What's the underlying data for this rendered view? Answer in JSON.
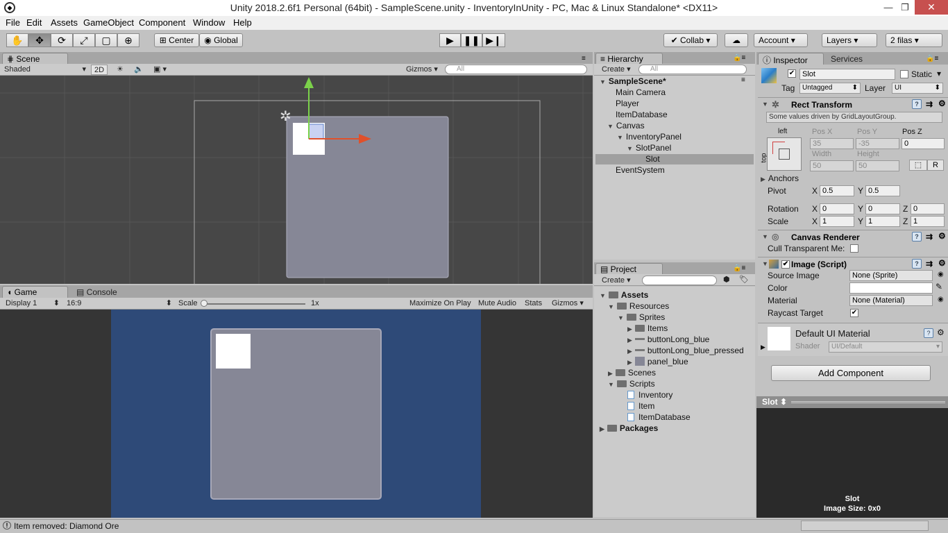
{
  "window": {
    "title": "Unity 2018.2.6f1 Personal (64bit) - SampleScene.unity - InventoryInUnity - PC, Mac & Linux Standalone* <DX11>"
  },
  "menu": [
    "File",
    "Edit",
    "Assets",
    "GameObject",
    "Component",
    "Window",
    "Help"
  ],
  "toolbar": {
    "center": "Center",
    "global": "Global",
    "collab": "Collab",
    "account": "Account",
    "layers": "Layers",
    "layout": "2 filas"
  },
  "scene": {
    "tab": "Scene",
    "shading": "Shaded",
    "mode_2d": "2D",
    "gizmos": "Gizmos",
    "search_placeholder": "All"
  },
  "game": {
    "tab": "Game",
    "console_tab": "Console",
    "display": "Display 1",
    "aspect": "16:9",
    "scale_label": "Scale",
    "scale_value": "1x",
    "maximize": "Maximize On Play",
    "mute": "Mute Audio",
    "stats": "Stats",
    "gizmos": "Gizmos"
  },
  "hierarchy": {
    "tab": "Hierarchy",
    "create": "Create",
    "search_placeholder": "All",
    "scene": "SampleScene*",
    "items": [
      "Main Camera",
      "Player",
      "ItemDatabase",
      "Canvas",
      "InventoryPanel",
      "SlotPanel",
      "Slot",
      "EventSystem"
    ]
  },
  "project": {
    "tab": "Project",
    "create": "Create",
    "items": [
      "Assets",
      "Resources",
      "Sprites",
      "Items",
      "buttonLong_blue",
      "buttonLong_blue_pressed",
      "panel_blue",
      "Scenes",
      "Scripts",
      "Inventory",
      "Item",
      "ItemDatabase",
      "Packages"
    ]
  },
  "inspector": {
    "tab": "Inspector",
    "services_tab": "Services",
    "object_name": "Slot",
    "static": "Static",
    "tag_label": "Tag",
    "tag_value": "Untagged",
    "layer_label": "Layer",
    "layer_value": "UI",
    "rect_transform": "Rect Transform",
    "driven_note": "Some values driven by GridLayoutGroup.",
    "anchor_h": "left",
    "anchor_v": "top",
    "posx_label": "Pos X",
    "posy_label": "Pos Y",
    "posz_label": "Pos Z",
    "posx": "35",
    "posy": "-35",
    "posz": "0",
    "width_label": "Width",
    "height_label": "Height",
    "width": "50",
    "height": "50",
    "r_button": "R",
    "anchors": "Anchors",
    "pivot_label": "Pivot",
    "pivot_x": "0.5",
    "pivot_y": "0.5",
    "rotation_label": "Rotation",
    "rot_x": "0",
    "rot_y": "0",
    "rot_z": "0",
    "scale_label": "Scale",
    "scale_x": "1",
    "scale_y": "1",
    "scale_z": "1",
    "x": "X",
    "y": "Y",
    "z": "Z",
    "canvas_renderer": "Canvas Renderer",
    "cull": "Cull Transparent Me:",
    "image_script": "Image (Script)",
    "source_image_label": "Source Image",
    "source_image": "None (Sprite)",
    "color_label": "Color",
    "material_label": "Material",
    "material": "None (Material)",
    "raycast_label": "Raycast Target",
    "default_material": "Default UI Material",
    "shader_label": "Shader",
    "shader_value": "UI/Default",
    "add_component": "Add Component",
    "preview_label": "Slot",
    "preview_name": "Slot",
    "image_size": "Image Size: 0x0"
  },
  "status": {
    "message": "Item removed: Diamond Ore"
  },
  "colors": {
    "game_bg": "#2e4a78",
    "panel": "#868796",
    "slot": "#ffffff",
    "scene_bg": "#474747"
  }
}
